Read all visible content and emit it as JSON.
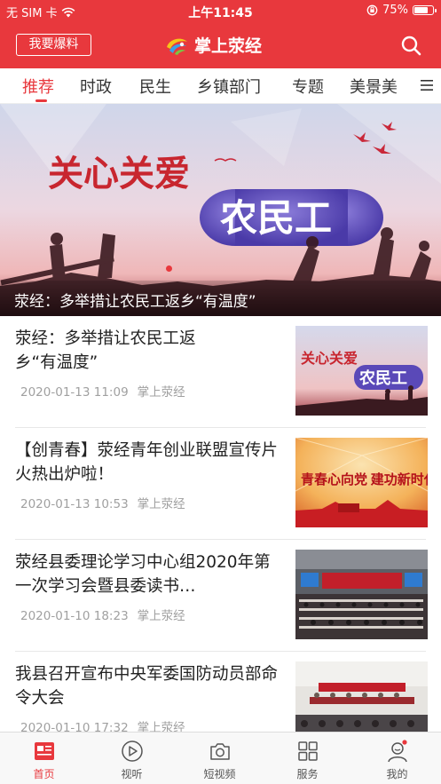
{
  "status": {
    "carrier": "无 SIM 卡",
    "time": "上午11:45",
    "battery": "75%",
    "battery_level": 0.75
  },
  "header": {
    "report_button": "我要爆料",
    "app_title": "掌上荥经"
  },
  "tabs": [
    {
      "label": "推荐",
      "active": true
    },
    {
      "label": "时政"
    },
    {
      "label": "民生"
    },
    {
      "label": "乡镇部门"
    },
    {
      "label": "专题"
    },
    {
      "label": "美景美"
    }
  ],
  "banner": {
    "caption": "荥经：多举措让农民工返乡“有温度”",
    "art_text_1": "关心关爱",
    "art_text_2": "农民工"
  },
  "news": [
    {
      "title": "荥经：多举措让农民工返乡“有温度”",
      "date": "2020-01-13 11:09",
      "source": "掌上荥经",
      "thumb": "migrant-workers"
    },
    {
      "title": "【创青春】荥经青年创业联盟宣传片火热出炉啦！",
      "date": "2020-01-13 10:53",
      "source": "掌上荥经",
      "thumb": "youth-poster",
      "thumb_text": "青春心向党 建功新时代"
    },
    {
      "title": "荥经县委理论学习中心组2020年第一次学习会暨县委读书…",
      "date": "2020-01-10 18:23",
      "source": "掌上荥经",
      "thumb": "meeting-hall"
    },
    {
      "title": "我县召开宣布中央军委国防动员部命令大会",
      "date": "2020-01-10 17:32",
      "source": "掌上荥经",
      "thumb": "conference"
    }
  ],
  "bottom_nav": [
    {
      "label": "首页",
      "icon": "news-icon",
      "active": true
    },
    {
      "label": "视听",
      "icon": "play-icon"
    },
    {
      "label": "短视频",
      "icon": "camera-icon"
    },
    {
      "label": "服务",
      "icon": "grid-icon"
    },
    {
      "label": "我的",
      "icon": "user-icon",
      "badge": true
    }
  ],
  "colors": {
    "brand_red": "#e8383d",
    "meta_gray": "#a0a0a0"
  }
}
